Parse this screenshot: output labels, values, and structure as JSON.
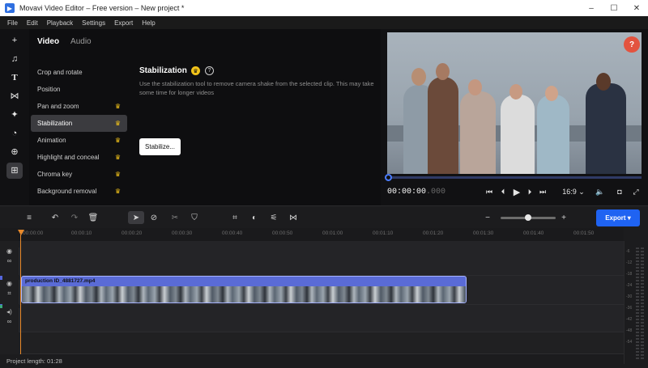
{
  "window": {
    "title": "Movavi Video Editor – Free version – New project *",
    "app_icon": "movavi-logo-icon",
    "controls": [
      "–",
      "☐",
      "✕"
    ]
  },
  "menu": [
    "File",
    "Edit",
    "Playback",
    "Settings",
    "Export",
    "Help"
  ],
  "tools": [
    {
      "icon": "add-media-icon",
      "glyph": "+"
    },
    {
      "icon": "music-icon",
      "glyph": "♫"
    },
    {
      "icon": "titles-icon",
      "glyph": "T"
    },
    {
      "icon": "transitions-icon",
      "glyph": "⋈"
    },
    {
      "icon": "stickers-icon",
      "glyph": "✦"
    },
    {
      "icon": "callouts-icon",
      "glyph": "◔"
    },
    {
      "icon": "more-tools-icon",
      "glyph": "⊞"
    }
  ],
  "panel": {
    "tabs": [
      "Video",
      "Audio"
    ],
    "active_tab": "Video",
    "categories": [
      {
        "label": "Crop and rotate",
        "premium": false
      },
      {
        "label": "Position",
        "premium": false
      },
      {
        "label": "Pan and zoom",
        "premium": true
      },
      {
        "label": "Stabilization",
        "premium": true,
        "selected": true
      },
      {
        "label": "Animation",
        "premium": true
      },
      {
        "label": "Highlight and conceal",
        "premium": true
      },
      {
        "label": "Chroma key",
        "premium": true
      },
      {
        "label": "Background removal",
        "premium": true
      }
    ],
    "detail": {
      "title": "Stabilization",
      "description": "Use the stabilization tool to remove camera shake from the selected clip. This may take some time for longer videos",
      "button_label": "Stabilize..."
    }
  },
  "preview": {
    "help_label": "?",
    "timecode_main": "00:00:00",
    "timecode_frac": ".000",
    "aspect_ratio": "16:9",
    "position_fraction": 0.0,
    "icons": [
      "skip-start-icon",
      "prev-frame-icon",
      "play-icon",
      "next-frame-icon",
      "skip-end-icon",
      "aspect-dropdown-icon",
      "volume-icon",
      "snapshot-icon",
      "fullscreen-icon"
    ]
  },
  "timeline_toolbar": {
    "icons": [
      "add-track-icon",
      "undo-icon",
      "redo-icon",
      "delete-icon",
      "select-tool-icon",
      "blade-off-icon",
      "cut-icon",
      "marker-icon",
      "crop-icon",
      "color-icon",
      "adjust-icon",
      "transitions-tool-icon",
      "zoom-out-icon",
      "zoom-in-icon"
    ],
    "zoom_fraction": 0.47,
    "export_label": "Export",
    "export_chevron": "▾",
    "accent_color": "#1f63f2"
  },
  "ruler": {
    "labels": [
      "00:00:00",
      "00:00:10",
      "00:00:20",
      "00:00:30",
      "00:00:40",
      "00:00:50",
      "00:01:00",
      "00:01:10",
      "00:01:20",
      "00:01:30",
      "00:01:40",
      "00:01:50"
    ]
  },
  "tracks": {
    "clip_name": "production ID_4881727.mp4",
    "clip_color": "#5a6bd6",
    "playhead_color": "#e8892a"
  },
  "vu_meter": [
    "-6",
    "-12",
    "-18",
    "-24",
    "-30",
    "-36",
    "-42",
    "-48",
    "-54"
  ],
  "status": {
    "project_length": "Project length: 01:28"
  }
}
